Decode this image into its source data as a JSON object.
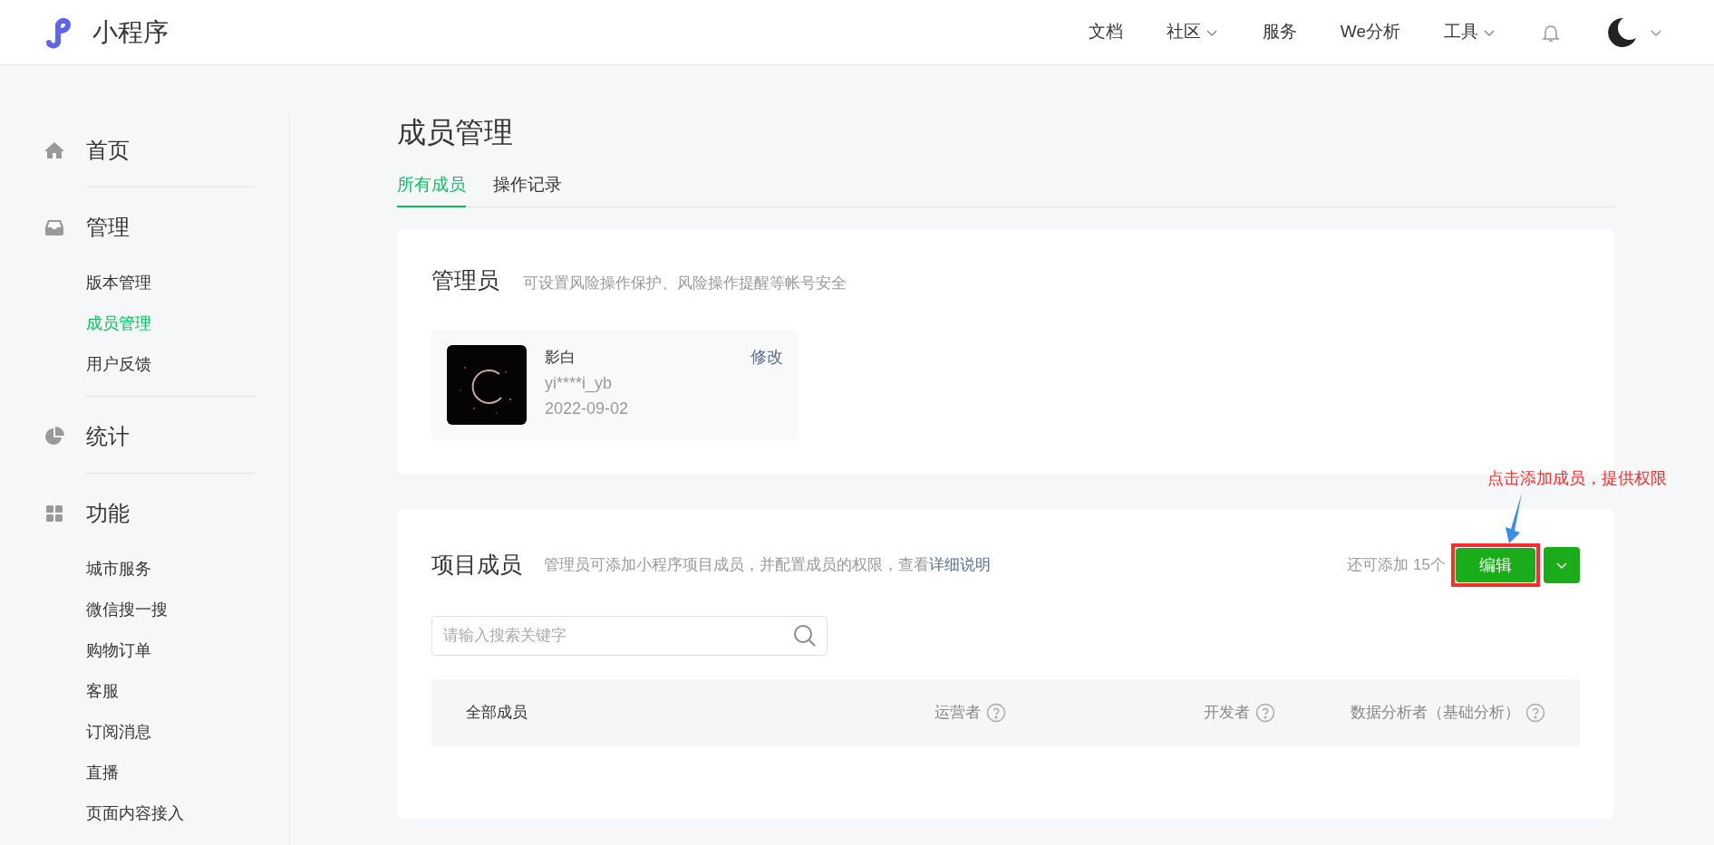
{
  "header": {
    "logo_text": "小程序",
    "nav": [
      {
        "label": "文档",
        "dropdown": false
      },
      {
        "label": "社区",
        "dropdown": true
      },
      {
        "label": "服务",
        "dropdown": false
      },
      {
        "label": "We分析",
        "dropdown": false
      },
      {
        "label": "工具",
        "dropdown": true
      }
    ]
  },
  "sidebar": {
    "sections": [
      {
        "kind": "home",
        "label": "首页"
      },
      {
        "kind": "inbox",
        "label": "管理",
        "items": [
          {
            "label": "版本管理",
            "selected": false
          },
          {
            "label": "成员管理",
            "selected": true
          },
          {
            "label": "用户反馈",
            "selected": false
          }
        ]
      },
      {
        "kind": "pie",
        "label": "统计"
      },
      {
        "kind": "grid",
        "label": "功能",
        "items": [
          {
            "label": "城市服务",
            "selected": false
          },
          {
            "label": "微信搜一搜",
            "selected": false
          },
          {
            "label": "购物订单",
            "selected": false
          },
          {
            "label": "客服",
            "selected": false
          },
          {
            "label": "订阅消息",
            "selected": false
          },
          {
            "label": "直播",
            "selected": false
          },
          {
            "label": "页面内容接入",
            "selected": false
          }
        ]
      }
    ]
  },
  "page": {
    "title": "成员管理",
    "tabs": [
      {
        "label": "所有成员",
        "selected": true
      },
      {
        "label": "操作记录",
        "selected": false
      }
    ]
  },
  "admin_card": {
    "title": "管理员",
    "hint": "可设置风险操作保护、风险操作提醒等帐号安全",
    "admin": {
      "name": "影白",
      "account": "yi****i_yb",
      "date": "2022-09-02",
      "action": "修改"
    }
  },
  "members_card": {
    "title": "项目成员",
    "hint": "管理员可添加小程序项目成员，并配置成员的权限，查看",
    "hint_link": "详细说明",
    "remaining": "还可添加 15个",
    "edit_button": "编辑",
    "search": {
      "placeholder": "请输入搜索关键字"
    },
    "columns": [
      {
        "label": "全部成员",
        "help": false
      },
      {
        "label": "运营者",
        "help": true
      },
      {
        "label": "开发者",
        "help": true
      },
      {
        "label": "数据分析者（基础分析）",
        "help": true
      }
    ]
  },
  "annotation": {
    "text": "点击添加成员，提供权限"
  }
}
